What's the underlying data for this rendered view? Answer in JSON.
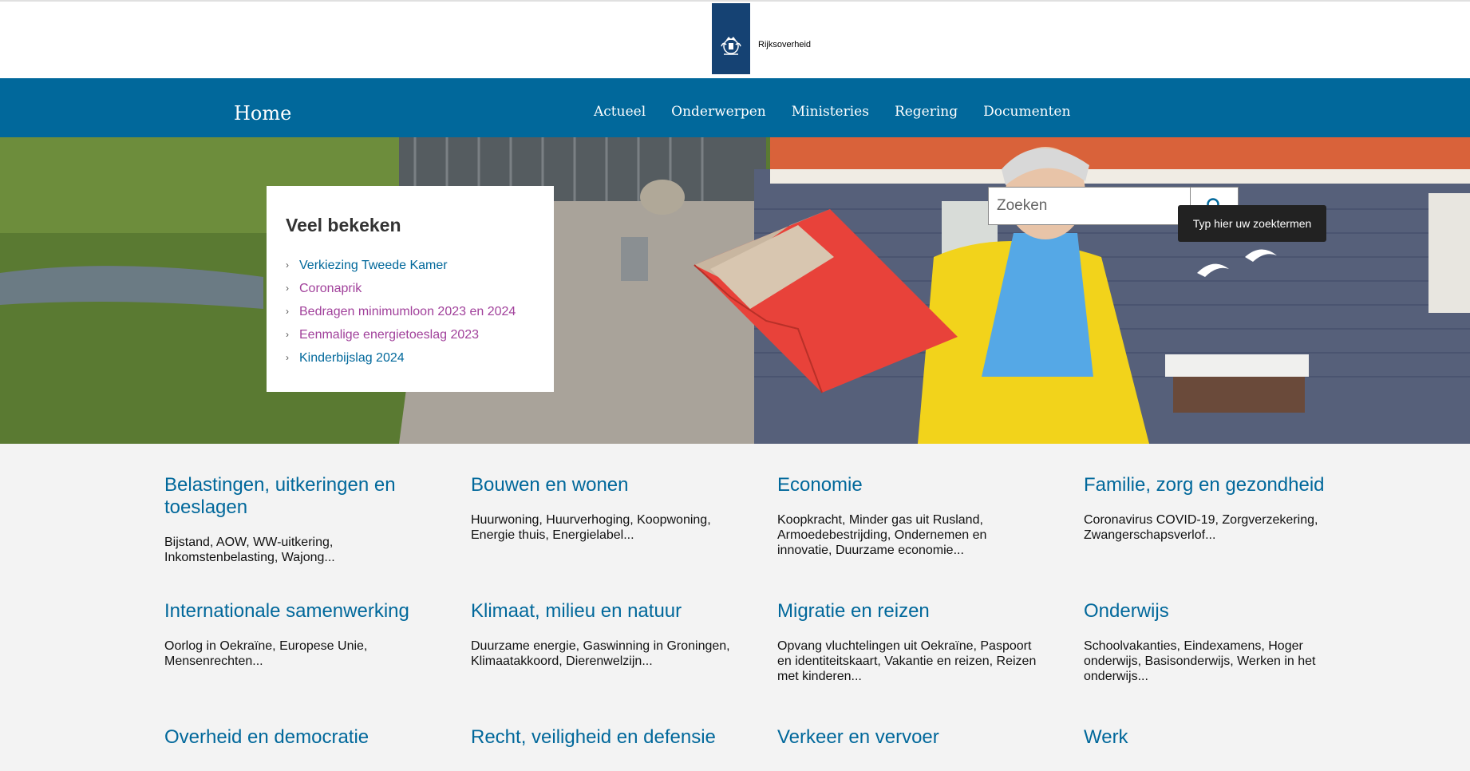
{
  "header": {
    "logo_text": "Rijksoverheid"
  },
  "nav": {
    "home": "Home",
    "links": [
      "Actueel",
      "Onderwerpen",
      "Ministeries",
      "Regering",
      "Documenten"
    ]
  },
  "popular": {
    "title": "Veel bekeken",
    "items": [
      {
        "label": "Verkiezing Tweede Kamer",
        "visited": false
      },
      {
        "label": "Coronaprik",
        "visited": true
      },
      {
        "label": "Bedragen minimumloon 2023 en 2024",
        "visited": true
      },
      {
        "label": "Eenmalige energietoeslag 2023",
        "visited": true
      },
      {
        "label": "Kinderbijslag 2024",
        "visited": false
      }
    ]
  },
  "search": {
    "placeholder": "Zoeken",
    "tooltip": "Typ hier uw zoektermen"
  },
  "topics": [
    {
      "title": "Belastingen, uitkeringen en toeslagen",
      "desc": "Bijstand, AOW, WW-uitkering, Inkomstenbelasting, Wajong..."
    },
    {
      "title": "Bouwen en wonen",
      "desc": "Huurwoning, Huurverhoging, Koopwoning, Energie thuis, Energielabel..."
    },
    {
      "title": "Economie",
      "desc": "Koopkracht, Minder gas uit Rusland, Armoedebestrijding, Ondernemen en innovatie, Duurzame economie..."
    },
    {
      "title": "Familie, zorg en gezondheid",
      "desc": "Coronavirus COVID-19, Zorgverzekering, Zwangerschapsverlof..."
    },
    {
      "title": "Internationale samenwerking",
      "desc": "Oorlog in Oekraïne, Europese Unie, Mensenrechten..."
    },
    {
      "title": "Klimaat, milieu en natuur",
      "desc": "Duurzame energie, Gaswinning in Groningen, Klimaatakkoord, Dierenwelzijn..."
    },
    {
      "title": "Migratie en reizen",
      "desc": "Opvang vluchtelingen uit Oekraïne, Paspoort en identiteitskaart, Vakantie en reizen, Reizen met kinderen..."
    },
    {
      "title": "Onderwijs",
      "desc": "Schoolvakanties, Eindexamens, Hoger onderwijs, Basisonderwijs, Werken in het onderwijs..."
    },
    {
      "title": "Overheid en democratie",
      "desc": ""
    },
    {
      "title": "Recht, veiligheid en defensie",
      "desc": ""
    },
    {
      "title": "Verkeer en vervoer",
      "desc": ""
    },
    {
      "title": "Werk",
      "desc": ""
    }
  ]
}
